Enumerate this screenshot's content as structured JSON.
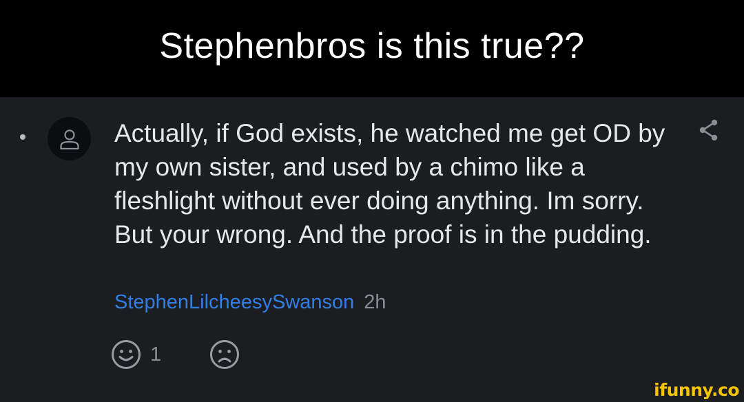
{
  "header": {
    "title": "Stephenbros is this true??"
  },
  "comment": {
    "avatar_icon": "user-icon",
    "text": "Actually, if God exists, he watched me get OD by my own sister, and used by a chimo like a fleshlight without ever doing anything. Im sorry. But your wrong. And the proof is in the pudding.",
    "username": "StephenLilcheesySwanson",
    "timestamp": "2h",
    "share_icon": "share-icon",
    "reactions": {
      "smile_icon": "smile-face-icon",
      "smile_count": "1",
      "sad_icon": "sad-face-icon"
    }
  },
  "watermark": "ifunny.co",
  "colors": {
    "background": "#000000",
    "panel": "#1c1d21",
    "username": "#2f7fe6",
    "watermark": "#f5c400"
  }
}
